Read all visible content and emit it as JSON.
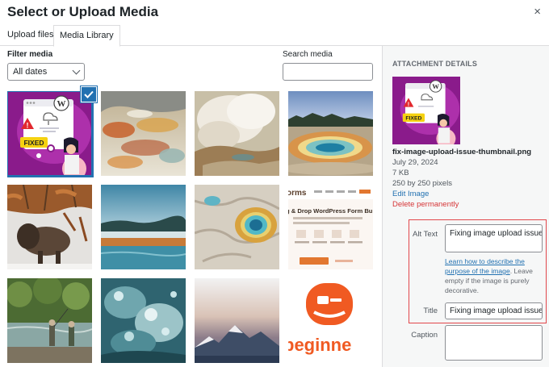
{
  "modal": {
    "title": "Select or Upload Media",
    "close": "×"
  },
  "tabs": [
    {
      "label": "Upload files"
    },
    {
      "label": "Media Library",
      "active": true
    }
  ],
  "filter": {
    "label": "Filter media",
    "selected": "All dates"
  },
  "search": {
    "label": "Search media",
    "value": ""
  },
  "grid": {
    "items": [
      {
        "name": "wp-thumbnail",
        "selected": true,
        "thumb_text": "FIXED"
      },
      {
        "name": "hot-spring-terrain"
      },
      {
        "name": "steaming-geyser"
      },
      {
        "name": "prismatic-spring"
      },
      {
        "name": "bison-in-snow"
      },
      {
        "name": "misty-lake"
      },
      {
        "name": "blue-hot-spring-aerial"
      },
      {
        "name": "wpforms-screenshot",
        "thumb_text": "orms",
        "thumb_text_2": "g & Drop WordPress Form Buil"
      },
      {
        "name": "fishermen-river"
      },
      {
        "name": "water-splash"
      },
      {
        "name": "mountain-dusk"
      },
      {
        "name": "wpbeginner-logo",
        "thumb_text": "beginne"
      }
    ]
  },
  "details": {
    "heading": "ATTACHMENT DETAILS",
    "filename": "fix-image-upload-issue-thumbnail.png",
    "date": "July 29, 2024",
    "size": "7 KB",
    "dimensions": "250 by 250 pixels",
    "edit_link": "Edit Image",
    "delete_link": "Delete permanently",
    "alt_label": "Alt Text",
    "alt_value": "Fixing image upload issue",
    "help_link": "Learn how to describe the purpose of the image",
    "help_rest": ". Leave empty if the image is purely decorative.",
    "title_label": "Title",
    "title_value": "Fixing image upload issue",
    "caption_label": "Caption",
    "caption_value": ""
  },
  "colors": {
    "accent": "#2271b1",
    "danger": "#d63638",
    "highlight": "#e2474b",
    "wp_purple": "#8a1b8b"
  }
}
